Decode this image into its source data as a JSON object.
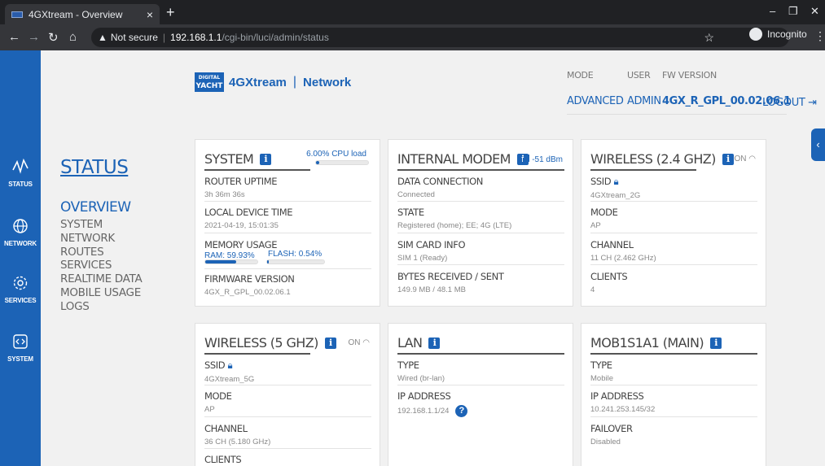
{
  "browser": {
    "tab_title": "4GXtream - Overview",
    "tab_close": "×",
    "new_tab": "+",
    "not_secure": "Not secure",
    "url_host": "192.168.1.1",
    "url_path": "/cgi-bin/luci/admin/status",
    "incognito": "Incognito"
  },
  "rail": {
    "items": [
      {
        "label": "STATUS",
        "icon": "pulse-icon"
      },
      {
        "label": "NETWORK",
        "icon": "globe-icon"
      },
      {
        "label": "SERVICES",
        "icon": "gear-icon"
      },
      {
        "label": "SYSTEM",
        "icon": "code-icon"
      }
    ]
  },
  "nav": {
    "title": "STATUS",
    "active": "OVERVIEW",
    "items": [
      "SYSTEM",
      "NETWORK",
      "ROUTES",
      "SERVICES",
      "REALTIME DATA",
      "MOBILE USAGE",
      "LOGS"
    ]
  },
  "header": {
    "logo_top": "DIGITAL",
    "logo_bottom": "YACHT",
    "product": "4GXtream",
    "separator": "|",
    "section": "Network",
    "mode_label": "MODE",
    "mode_value": "ADVANCED",
    "user_label": "USER",
    "user_value": "ADMIN",
    "fw_label": "FW VERSION",
    "fw_value": "4GX_R_GPL_00.02.06.1",
    "logout": "LOGOUT"
  },
  "cards": {
    "system": {
      "title": "SYSTEM",
      "cpu_label": "6.00% CPU load",
      "cpu_fraction": 0.06,
      "uptime_label": "ROUTER UPTIME",
      "uptime_value": "3h 36m 36s",
      "time_label": "LOCAL DEVICE TIME",
      "time_value": "2021-04-19, 15:01:35",
      "memory_label": "MEMORY USAGE",
      "ram_label": "RAM: 59.93%",
      "ram_fraction": 0.5993,
      "flash_label": "FLASH: 0.54%",
      "flash_fraction": 0.0054,
      "firmware_label": "FIRMWARE VERSION",
      "firmware_value": "4GX_R_GPL_00.02.06.1"
    },
    "modem": {
      "title": "INTERNAL MODEM",
      "signal": "-51 dBm",
      "data_label": "DATA CONNECTION",
      "data_value": "Connected",
      "state_label": "STATE",
      "state_value": "Registered (home); EE; 4G (LTE)",
      "sim_label": "SIM CARD INFO",
      "sim_value": "SIM 1 (Ready)",
      "bytes_label": "BYTES RECEIVED / SENT",
      "bytes_value": "149.9 MB / 48.1 MB"
    },
    "wifi24": {
      "title": "WIRELESS (2.4 GHZ)",
      "status": "ON",
      "ssid_label": "SSID",
      "ssid_value": "4GXtream_2G",
      "mode_label": "MODE",
      "mode_value": "AP",
      "channel_label": "CHANNEL",
      "channel_value": "11 CH (2.462 GHz)",
      "clients_label": "CLIENTS",
      "clients_value": "4"
    },
    "wifi5": {
      "title": "WIRELESS (5 GHZ)",
      "status": "ON",
      "ssid_label": "SSID",
      "ssid_value": "4GXtream_5G",
      "mode_label": "MODE",
      "mode_value": "AP",
      "channel_label": "CHANNEL",
      "channel_value": "36 CH (5.180 GHz)",
      "clients_label": "CLIENTS"
    },
    "lan": {
      "title": "LAN",
      "type_label": "TYPE",
      "type_value": "Wired (br-lan)",
      "ip_label": "IP ADDRESS",
      "ip_value": "192.168.1.1/24",
      "help": "?"
    },
    "mob": {
      "title": "MOB1S1A1 (MAIN)",
      "type_label": "TYPE",
      "type_value": "Mobile",
      "ip_label": "IP ADDRESS",
      "ip_value": "10.241.253.145/32",
      "failover_label": "FAILOVER",
      "failover_value": "Disabled"
    }
  },
  "colors": {
    "accent": "#1c63b6",
    "chrome": "#35363a"
  }
}
